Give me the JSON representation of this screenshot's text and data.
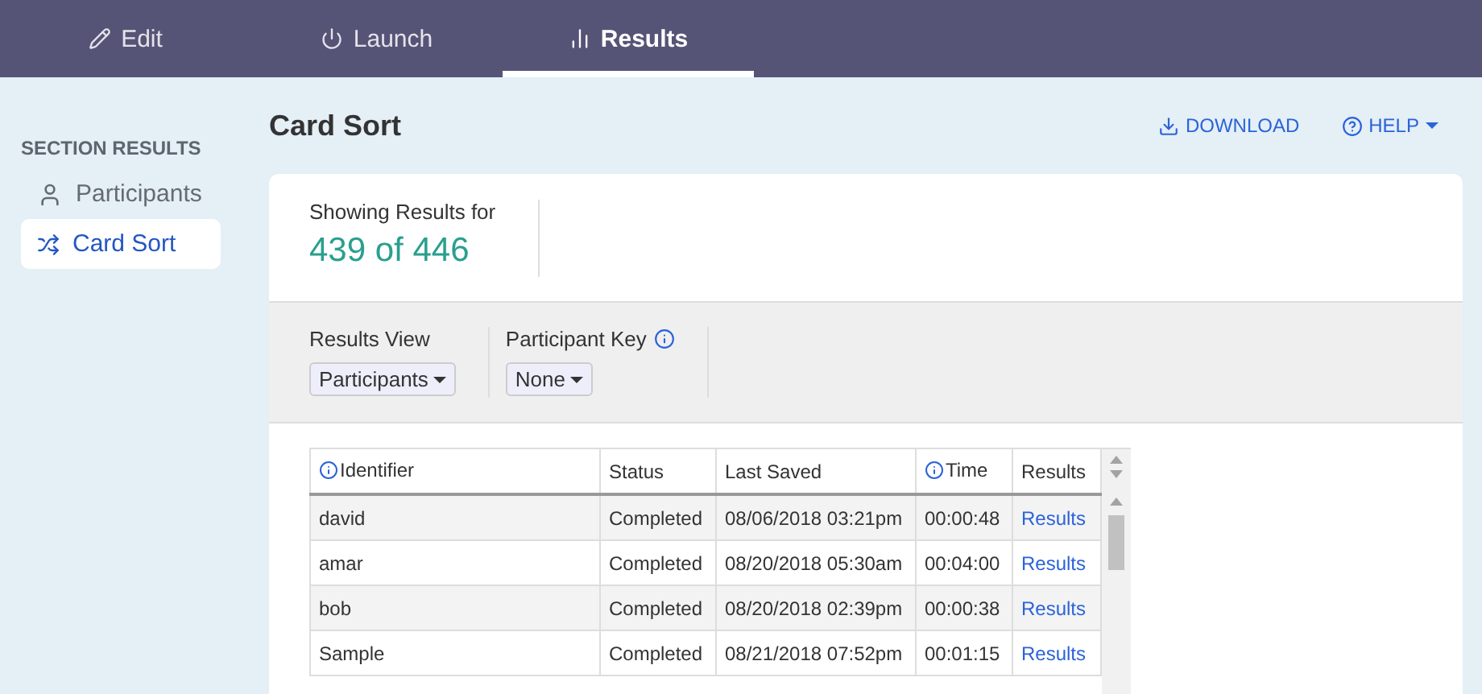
{
  "nav_tabs": [
    {
      "label": "Edit",
      "selected": false
    },
    {
      "label": "Launch",
      "selected": false
    },
    {
      "label": "Results",
      "selected": true
    }
  ],
  "sidebar": {
    "heading": "SECTION RESULTS",
    "items": [
      {
        "label": "Participants",
        "selected": false
      },
      {
        "label": "Card Sort",
        "selected": true
      }
    ]
  },
  "page_title": "Card Sort",
  "actions": {
    "download": "DOWNLOAD",
    "help": "HELP"
  },
  "summary": {
    "label": "Showing Results for",
    "value": "439 of 446"
  },
  "filters": [
    {
      "label": "Results View",
      "value": "Participants",
      "info": false
    },
    {
      "label": "Participant Key",
      "value": "None",
      "info": true
    }
  ],
  "table": {
    "columns": [
      {
        "label": "Identifier",
        "info": true
      },
      {
        "label": "Status",
        "info": false
      },
      {
        "label": "Last Saved",
        "info": false
      },
      {
        "label": "Time",
        "info": true
      },
      {
        "label": "Results",
        "info": false
      }
    ],
    "rows": [
      [
        "david",
        "Completed",
        "08/06/2018 03:21pm",
        "00:00:48",
        "Results"
      ],
      [
        "amar",
        "Completed",
        "08/20/2018 05:30am",
        "00:04:00",
        "Results"
      ],
      [
        "bob",
        "Completed",
        "08/20/2018 02:39pm",
        "00:00:38",
        "Results"
      ],
      [
        "Sample",
        "Completed",
        "08/21/2018 07:52pm",
        "00:01:15",
        "Results"
      ]
    ]
  }
}
